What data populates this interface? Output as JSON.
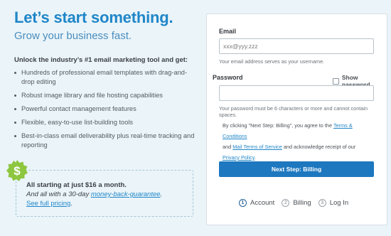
{
  "hero": {
    "headline": "Let’s start something.",
    "subhead": "Grow your business fast."
  },
  "features": {
    "intro": "Unlock the industry’s #1 email marketing tool and get:",
    "items": [
      "Hundreds of professional email templates with drag-and-drop editing",
      "Robust image library and file hosting capabilities",
      "Powerful contact management features",
      "Flexible, easy-to-use list-building tools",
      "Best-in-class email deliverability plus real-time tracking and reporting"
    ]
  },
  "pricing": {
    "badge_icon": "dollar-badge-icon",
    "price_line": "All starting at just $16 a month.",
    "guarantee_prefix": "And all with a 30-day ",
    "guarantee_link": "money-back-guarantee",
    "guarantee_suffix": ".",
    "see_pricing": "See full pricing",
    "see_pricing_suffix": "."
  },
  "form": {
    "email_label": "Email",
    "email_placeholder": "xxx@yyy.zzz",
    "email_value": "",
    "email_help": "Your email address serves as your username.",
    "password_label": "Password",
    "show_password_label": "Show password",
    "password_value": "",
    "password_help": "Your password must be 6 characters or more and cannot contain spaces.",
    "terms_prefix": "By clicking \"Next Step: Billing\", you agree to the ",
    "terms_link": "Terms & Conditions",
    "terms_and": "and ",
    "mail_terms_link": "Mail Terms of Service",
    "terms_mid": " and acknowledge receipt of our ",
    "privacy_link": "Privacy Policy",
    "terms_end": ".",
    "submit_label": "Next Step: Billing"
  },
  "steps": [
    {
      "number": "1",
      "label": "Account",
      "active": true
    },
    {
      "number": "2",
      "label": "Billing",
      "active": false
    },
    {
      "number": "3",
      "label": "Log In",
      "active": false
    }
  ],
  "colors": {
    "accent": "#1f86c8",
    "button": "#1e78bf",
    "background": "#eaf4f9",
    "badge": "#8dc63f"
  }
}
